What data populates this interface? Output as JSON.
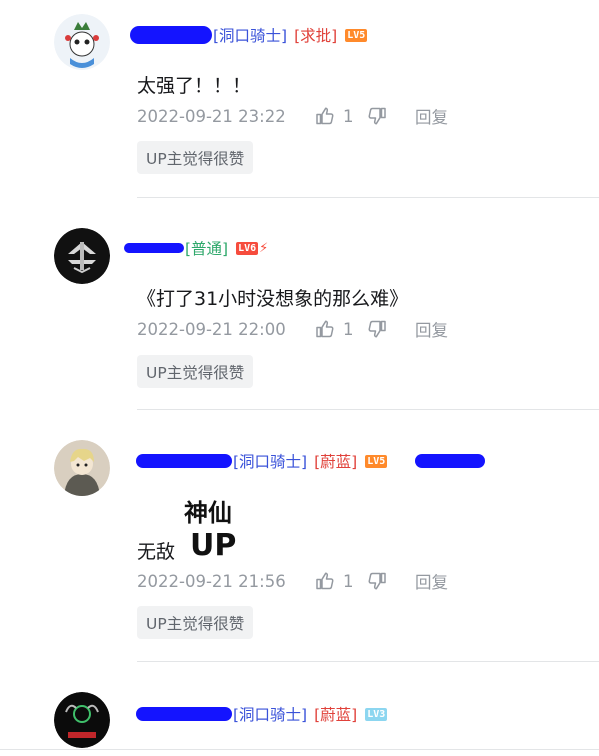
{
  "comments": [
    {
      "tags": [
        "[洞口骑士]",
        "[求批]"
      ],
      "level": "LV5",
      "text": "太强了！！！",
      "time": "2022-09-21 23:22",
      "likes": "1",
      "reply": "回复",
      "badge": "UP主觉得很赞"
    },
    {
      "tags": [
        "[普通]"
      ],
      "level": "LV6",
      "level_extra": "⚡",
      "text": "《打了31小时没想象的那么难》",
      "time": "2022-09-21 22:00",
      "likes": "1",
      "reply": "回复",
      "badge": "UP主觉得很赞"
    },
    {
      "tags": [
        "[洞口骑士]",
        "[蔚蓝]"
      ],
      "level": "LV5",
      "text": "无敌",
      "sticker_text": [
        "神仙",
        "UP"
      ],
      "time": "2022-09-21 21:56",
      "likes": "1",
      "reply": "回复",
      "badge": "UP主觉得很赞"
    },
    {
      "tags": [
        "[洞口骑士]",
        "[蔚蓝]"
      ],
      "level": "LV3"
    }
  ],
  "colors": {
    "knight_tag": "#3a52d9",
    "red_tag": "#e0413a",
    "green_tag": "#2fa86b",
    "meta_gray": "#9499a0",
    "badge_bg": "#f1f2f3",
    "redaction_blue": "#1414ff"
  },
  "icons": [
    "like-icon",
    "dislike-icon"
  ]
}
